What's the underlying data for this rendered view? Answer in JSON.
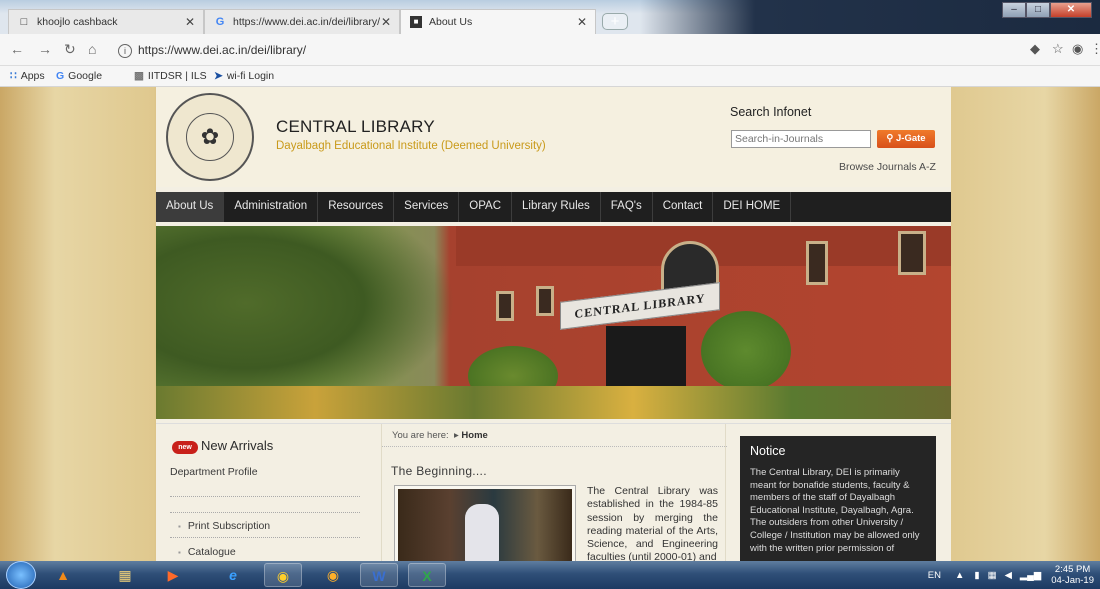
{
  "browser": {
    "tabs": [
      {
        "title": "khoojlo cashback",
        "active": false
      },
      {
        "title": "https://www.dei.ac.in/dei/library/",
        "active": false
      },
      {
        "title": "About Us",
        "active": true
      }
    ],
    "url": "https://www.dei.ac.in/dei/library/",
    "bookmarks": [
      "Apps",
      "Google",
      "IITDSR | ILS",
      "wi-fi Login"
    ]
  },
  "header": {
    "title": "CENTRAL LIBRARY",
    "subtitle": "Dayalbagh Educational Institute (Deemed University)",
    "search_label": "Search Infonet",
    "search_placeholder": "Search-in-Journals",
    "search_button": "J-Gate",
    "browse_link": "Browse Journals A-Z"
  },
  "menu": [
    {
      "label": "About Us",
      "active": true
    },
    {
      "label": "Administration",
      "active": false
    },
    {
      "label": "Resources",
      "active": false
    },
    {
      "label": "Services",
      "active": false
    },
    {
      "label": "OPAC",
      "active": false
    },
    {
      "label": "Library Rules",
      "active": false
    },
    {
      "label": "FAQ's",
      "active": false
    },
    {
      "label": "Contact",
      "active": false
    },
    {
      "label": "DEI HOME",
      "active": false
    }
  ],
  "banner": {
    "sign": "CENTRAL LIBRARY"
  },
  "sidebar": {
    "new_badge": "new",
    "new_arrivals": "New Arrivals",
    "department_profile": "Department Profile",
    "links": [
      "Print Subscription",
      "Catalogue"
    ]
  },
  "main": {
    "breadcrumb_prefix": "You are here:",
    "breadcrumb_current": "Home",
    "heading": "The Beginning....",
    "paragraph": "The Central Library was established in the 1984-85 session by merging the reading material of the Arts, Science, and Engineering faculties (until 2000-01) and"
  },
  "notice": {
    "title": "Notice",
    "text": "The Central Library, DEI is primarily meant for bonafide students, faculty & members of the staff of Dayalbagh Educational Institute, Dayalbagh, Agra. The outsiders from other University / College / Institution may be allowed only with the written prior permission of"
  },
  "taskbar": {
    "lang": "EN",
    "time": "2:45 PM",
    "date": "04-Jan-19"
  }
}
